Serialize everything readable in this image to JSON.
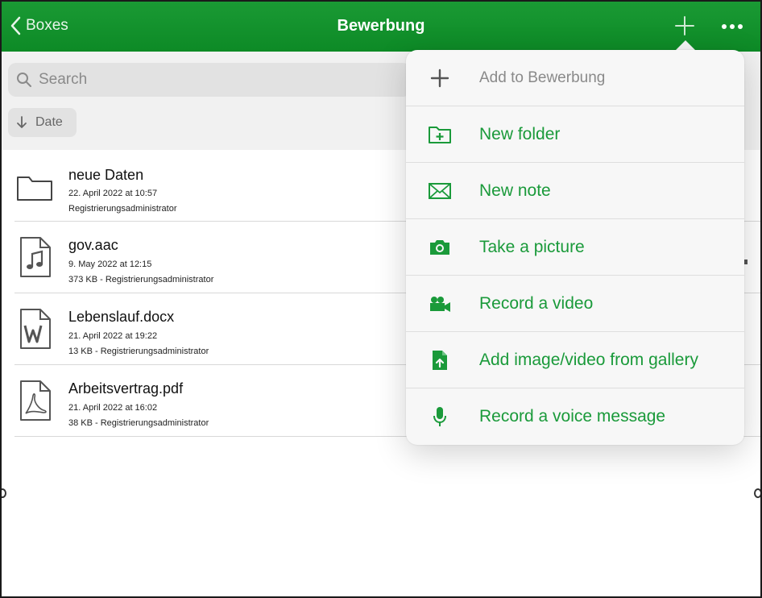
{
  "header": {
    "back_label": "Boxes",
    "title": "Bewerbung"
  },
  "search": {
    "placeholder": "Search"
  },
  "sort": {
    "label": "Date"
  },
  "files": [
    {
      "name": "neue Daten",
      "date": "22. April 2022 at 10:57",
      "meta": "Registrierungsadministrator",
      "icon": "folder-icon"
    },
    {
      "name": "gov.aac",
      "date": "9. May 2022 at 12:15",
      "meta": "373 KB  -  Registrierungsadministrator",
      "icon": "audio-file-icon"
    },
    {
      "name": "Lebenslauf.docx",
      "date": "21. April 2022 at 19:22",
      "meta": "13 KB  -  Registrierungsadministrator",
      "icon": "word-file-icon"
    },
    {
      "name": "Arbeitsvertrag.pdf",
      "date": "21. April 2022 at 16:02",
      "meta": "38 KB  -  Registrierungsadministrator",
      "icon": "pdf-file-icon"
    }
  ],
  "menu": {
    "items": [
      {
        "label": "Add to Bewerbung",
        "icon": "plus-icon",
        "disabled": true
      },
      {
        "label": "New folder",
        "icon": "new-folder-icon"
      },
      {
        "label": "New note",
        "icon": "note-icon"
      },
      {
        "label": "Take a picture",
        "icon": "camera-icon"
      },
      {
        "label": "Record a video",
        "icon": "video-camera-icon"
      },
      {
        "label": "Add image/video from gallery",
        "icon": "gallery-upload-icon"
      },
      {
        "label": "Record a voice message",
        "icon": "microphone-icon"
      }
    ]
  },
  "colors": {
    "header_green": "#0d8a26",
    "accent_green": "#1a9a3a"
  }
}
